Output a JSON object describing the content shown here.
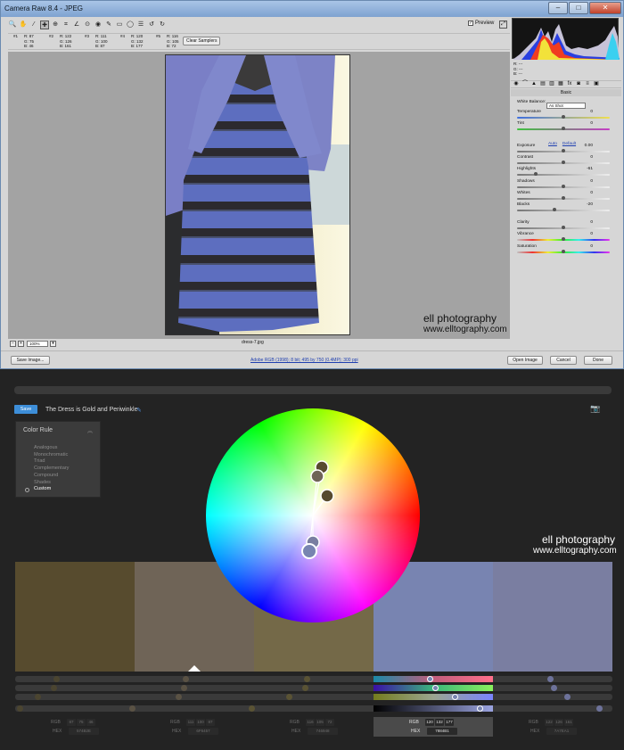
{
  "camera_raw": {
    "window_title": "Camera Raw 8.4  -  JPEG",
    "preview_label": "Preview",
    "clear_samplers_label": "Clear Samplers",
    "samplers": [
      {
        "num": "#1",
        "r": "R: 87",
        "g": "G: 75",
        "b": "B: 46"
      },
      {
        "num": "#2",
        "r": "R: 122",
        "g": "G: 126",
        "b": "B: 161"
      },
      {
        "num": "#3",
        "r": "R: 111",
        "g": "G: 100",
        "b": "B: 87"
      },
      {
        "num": "#4",
        "r": "R: 120",
        "g": "G: 132",
        "b": "B: 177"
      },
      {
        "num": "#5",
        "r": "R: 116",
        "g": "G: 105",
        "b": "B: 72"
      }
    ],
    "watermark_line1": "ell photography",
    "watermark_line2": "www.elltography.com",
    "zoom": "100%",
    "filename": "dress-7.jpg",
    "workflow_link": "Adobe RGB (1998); 8 bit; 495 by 750 (0.4MP); 300 ppi",
    "buttons": {
      "save_image": "Save Image...",
      "open_image": "Open Image",
      "cancel": "Cancel",
      "done": "Done"
    },
    "rgb_readout": {
      "r": "R:   ---",
      "g": "G:   ---",
      "b": "B:   ---"
    },
    "panel_title": "Basic",
    "white_balance_label": "White Balance:",
    "white_balance_value": "As Shot",
    "auto_label": "Auto",
    "default_label": "Default",
    "adjustments": [
      {
        "label": "Temperature",
        "value": "0",
        "pos": 0.5,
        "track": "temp"
      },
      {
        "label": "Tint",
        "value": "0",
        "pos": 0.5,
        "track": "tint"
      },
      {
        "label": "Exposure",
        "value": "0.00",
        "pos": 0.5,
        "track": "gray"
      },
      {
        "label": "Contrast",
        "value": "0",
        "pos": 0.5,
        "track": "gray"
      },
      {
        "label": "Highlights",
        "value": "-61",
        "pos": 0.2,
        "track": "gray"
      },
      {
        "label": "Shadows",
        "value": "0",
        "pos": 0.5,
        "track": "gray"
      },
      {
        "label": "Whites",
        "value": "0",
        "pos": 0.5,
        "track": "gray"
      },
      {
        "label": "Blacks",
        "value": "-20",
        "pos": 0.4,
        "track": "gray"
      },
      {
        "label": "Clarity",
        "value": "0",
        "pos": 0.5,
        "track": "gray"
      },
      {
        "label": "Vibrance",
        "value": "0",
        "pos": 0.5,
        "track": "rainbow"
      },
      {
        "label": "Saturation",
        "value": "0",
        "pos": 0.5,
        "track": "rainbow"
      }
    ]
  },
  "color_app": {
    "save_label": "Save",
    "theme_name": "The Dress is Gold and Periwinkle",
    "color_rule_title": "Color Rule",
    "rules": [
      "Analogous",
      "Monochromatic",
      "Triad",
      "Complementary",
      "Compound",
      "Shades",
      "Custom"
    ],
    "selected_rule": "Custom",
    "watermark_line1": "ell photography",
    "watermark_line2": "www.elltography.com",
    "swatches": [
      {
        "color": "#574b2e",
        "rgb": [
          "87",
          "75",
          "46"
        ],
        "hex": "574B2E"
      },
      {
        "color": "#6f6457",
        "rgb": [
          "111",
          "100",
          "87"
        ],
        "hex": "6F6457"
      },
      {
        "color": "#746948",
        "rgb": [
          "116",
          "105",
          "72"
        ],
        "hex": "746948"
      },
      {
        "color": "#7884b1",
        "rgb": [
          "120",
          "132",
          "177"
        ],
        "hex": "7884B1"
      },
      {
        "color": "#7a7ea1",
        "rgb": [
          "122",
          "126",
          "161"
        ],
        "hex": "7A7EA1"
      }
    ],
    "active_swatch": 3,
    "rgb_label": "RGB",
    "hex_label": "HEX"
  }
}
